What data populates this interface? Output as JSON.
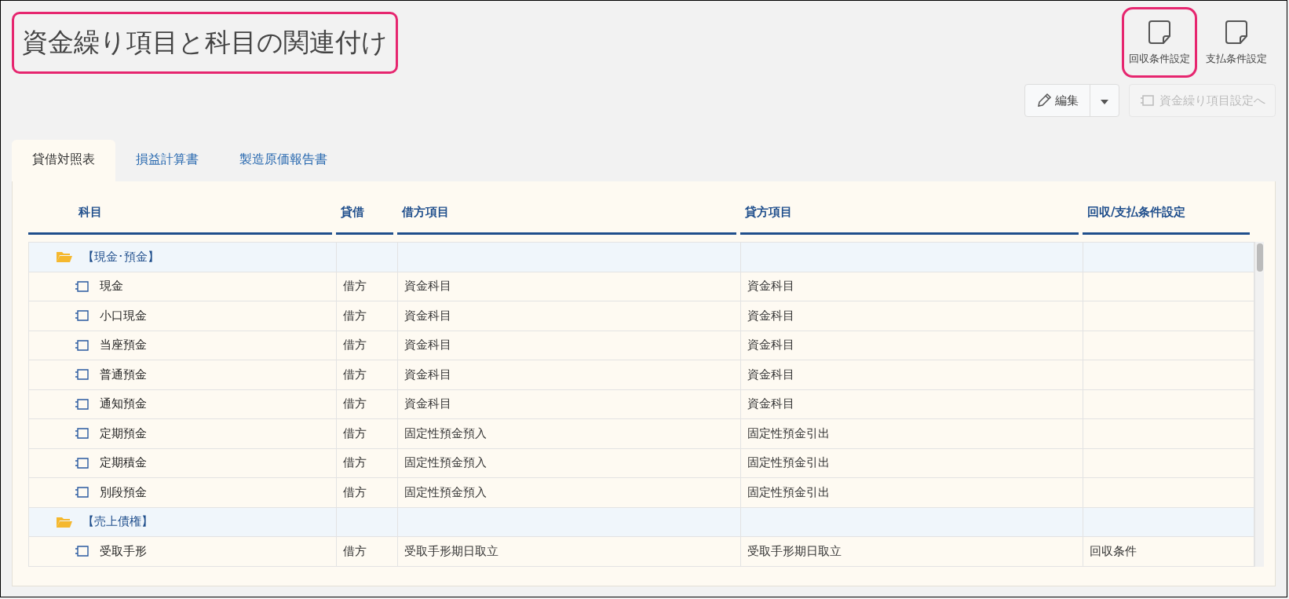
{
  "title": {
    "text": "資金繰り項目と科目の関連付け",
    "highlighted": true
  },
  "icon_buttons": [
    {
      "label": "回収条件設定",
      "highlighted": true
    },
    {
      "label": "支払条件設定",
      "highlighted": false
    }
  ],
  "edit_button": {
    "label": "編集"
  },
  "link_button": {
    "label": "資金繰り項目設定へ",
    "disabled": true
  },
  "tabs": [
    {
      "label": "貸借対照表",
      "selected": true
    },
    {
      "label": "損益計算書",
      "selected": false
    },
    {
      "label": "製造原価報告書",
      "selected": false
    }
  ],
  "table": {
    "columns": [
      "科目",
      "貸借",
      "借方項目",
      "貸方項目",
      "回収/支払条件設定"
    ],
    "groups": [
      {
        "name": "【現金･預金】",
        "expanded": true,
        "children": [
          {
            "name": "現金",
            "side": "借方",
            "debit": "資金科目",
            "credit": "資金科目"
          },
          {
            "name": "小口現金",
            "side": "借方",
            "debit": "資金科目",
            "credit": "資金科目"
          },
          {
            "name": "当座預金",
            "side": "借方",
            "debit": "資金科目",
            "credit": "資金科目"
          },
          {
            "name": "普通預金",
            "side": "借方",
            "debit": "資金科目",
            "credit": "資金科目"
          },
          {
            "name": "通知預金",
            "side": "借方",
            "debit": "資金科目",
            "credit": "資金科目"
          },
          {
            "name": "定期預金",
            "side": "借方",
            "debit": "固定性預金預入",
            "credit": "固定性預金引出"
          },
          {
            "name": "定期積金",
            "side": "借方",
            "debit": "固定性預金預入",
            "credit": "固定性預金引出"
          },
          {
            "name": "別段預金",
            "side": "借方",
            "debit": "固定性預金預入",
            "credit": "固定性預金引出"
          }
        ]
      },
      {
        "name": "【売上債権】",
        "expanded": true,
        "children": [
          {
            "name": "受取手形",
            "side": "借方",
            "debit": "受取手形期日取立",
            "credit": "受取手形期日取立",
            "condition": "回収条件"
          }
        ]
      }
    ]
  }
}
